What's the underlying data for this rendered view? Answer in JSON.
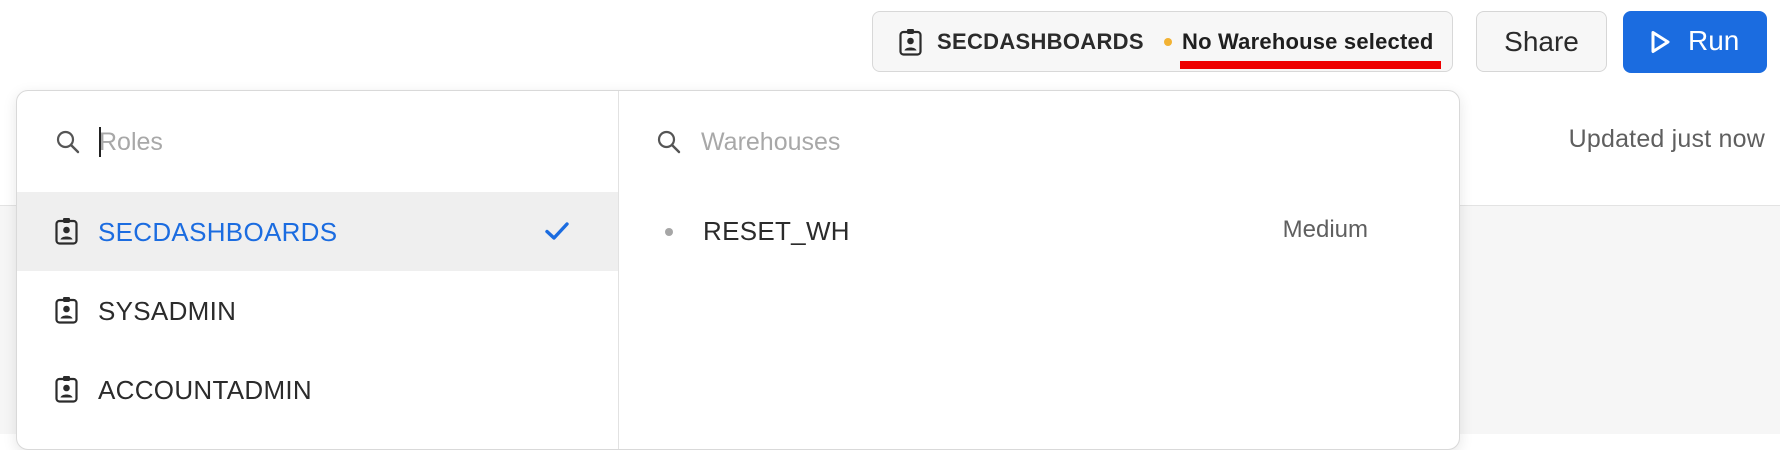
{
  "header": {
    "current_role": "SECDASHBOARDS",
    "warehouse_status": "No Warehouse selected",
    "share_label": "Share",
    "run_label": "Run",
    "colors": {
      "accent": "#1b6ce0",
      "status_dot": "#f2b233",
      "annotation_underline": "#ee0000"
    }
  },
  "page": {
    "updated_text": "Updated just now"
  },
  "dropdown": {
    "roles_search": {
      "placeholder": "Roles",
      "value": ""
    },
    "warehouses_search": {
      "placeholder": "Warehouses",
      "value": ""
    },
    "roles": [
      {
        "label": "SECDASHBOARDS",
        "selected": true,
        "icon": "role-badge-icon"
      },
      {
        "label": "SYSADMIN",
        "selected": false,
        "icon": "role-badge-icon"
      },
      {
        "label": "ACCOUNTADMIN",
        "selected": false,
        "icon": "role-badge-icon"
      }
    ],
    "warehouses": [
      {
        "name": "RESET_WH",
        "size": "Medium"
      }
    ]
  }
}
